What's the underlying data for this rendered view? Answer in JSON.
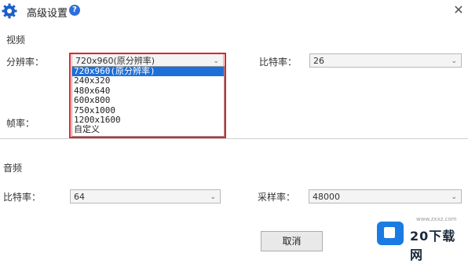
{
  "window": {
    "title": "高级设置",
    "help_glyph": "?",
    "close_glyph": "✕"
  },
  "video": {
    "section_title": "视频",
    "resolution_label": "分辨率：",
    "resolution_value": "720x960(原分辨率)",
    "bitrate_label": "比特率：",
    "bitrate_value": "26",
    "framerate_label": "帧率："
  },
  "resolution_options": [
    "720x960(原分辨率)",
    "240x320",
    "480x640",
    "600x800",
    "750x1000",
    "1200x1600",
    "自定义"
  ],
  "audio": {
    "section_title": "音频",
    "bitrate_label": "比特率：",
    "bitrate_value": "64",
    "samplerate_label": "采样率：",
    "samplerate_value": "48000"
  },
  "buttons": {
    "cancel_label": "取消"
  },
  "watermark": {
    "brand": "20下载网",
    "url": "www.zxxz.com"
  },
  "icons": {
    "app": "gear-icon",
    "help": "help-icon",
    "close": "close-icon",
    "dropdown": "chevron-down-icon"
  },
  "colors": {
    "selection": "#1e6fd9",
    "highlight_border": "#e0242a",
    "help_icon": "#2d6fd8",
    "brand_blue": "#1a7be3"
  }
}
